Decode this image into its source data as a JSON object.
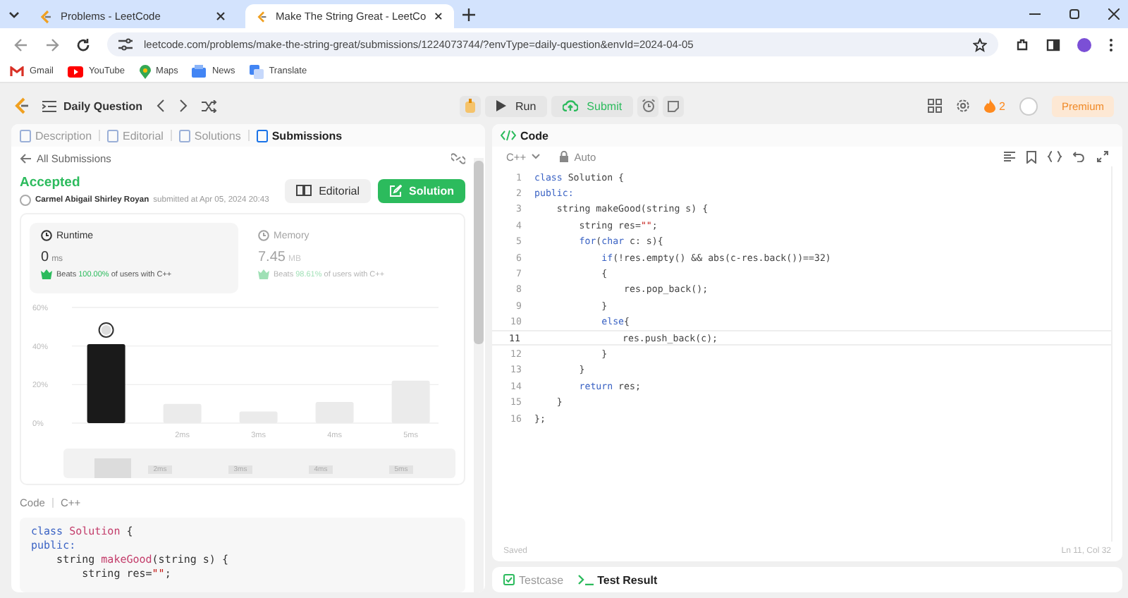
{
  "browser": {
    "tabs": [
      {
        "title": "Problems - LeetCode",
        "selected": false
      },
      {
        "title": "Make The String Great - LeetCo",
        "selected": true
      }
    ],
    "url": "leetcode.com/problems/make-the-string-great/submissions/1224073744/?envType=daily-question&envId=2024-04-05",
    "bookmarks": [
      {
        "label": "Gmail",
        "kind": "mail"
      },
      {
        "label": "YouTube",
        "kind": "video"
      },
      {
        "label": "Maps",
        "kind": "pin"
      },
      {
        "label": "News",
        "kind": "news"
      },
      {
        "label": "Translate",
        "kind": "translate"
      }
    ]
  },
  "toolbar": {
    "title": "Daily Question",
    "run": "Run",
    "submit": "Submit",
    "streak": "2",
    "premium": "Premium"
  },
  "left": {
    "tabs": [
      {
        "label": "Description",
        "selected": false
      },
      {
        "label": "Editorial",
        "selected": false
      },
      {
        "label": "Solutions",
        "selected": false
      },
      {
        "label": "Submissions",
        "selected": true
      }
    ],
    "back": "All Submissions",
    "status": "Accepted",
    "author": "Carmel Abigail Shirley Royan",
    "submitted": "submitted at Apr 05, 2024 20:43",
    "editorial_button": "Editorial",
    "solution_button": "Solution",
    "stats": [
      {
        "label": "Runtime",
        "value": "0",
        "unit": "ms",
        "beats": "Beats",
        "percent": "100.00%",
        "suffix": "of users with C++",
        "selected": true
      },
      {
        "label": "Memory",
        "value": "7.45",
        "unit": "MB",
        "beats": "Beats",
        "percent": "98.61%",
        "suffix": "of users with C++",
        "selected": false
      }
    ],
    "chart_data": {
      "type": "bar",
      "categories": [
        null,
        "2ms",
        "3ms",
        "4ms",
        "5ms"
      ],
      "values": [
        41,
        10,
        6,
        11,
        22
      ],
      "ylim": [
        0,
        60
      ],
      "yticks": [
        {
          "value": 0,
          "label": "0%"
        },
        {
          "value": 20,
          "label": "20%"
        },
        {
          "value": 40,
          "label": "40%"
        },
        {
          "value": 60,
          "label": "60%"
        }
      ]
    },
    "overview_labels": [
      "2ms",
      "3ms",
      "4ms",
      "5ms"
    ],
    "code_label": "Code",
    "code_lang": "C++",
    "snippet": [
      [
        {
          "t": "class ",
          "kind": "keyword"
        },
        {
          "t": "Solution",
          "kind": "name"
        },
        {
          "t": " {",
          "kind": "plain"
        }
      ],
      [
        {
          "t": "public:",
          "kind": "keyword"
        }
      ],
      [
        {
          "t": "    string ",
          "kind": "plain"
        },
        {
          "t": "makeGood",
          "kind": "name"
        },
        {
          "t": "(string s) {",
          "kind": "plain"
        }
      ],
      [
        {
          "t": "        string res=",
          "kind": "plain"
        },
        {
          "t": "\"\"",
          "kind": "string"
        },
        {
          "t": ";",
          "kind": "plain"
        }
      ]
    ]
  },
  "editor": {
    "title": "Code",
    "lang": "C++",
    "mode": "Auto",
    "status": "Saved",
    "position": "Ln 11, Col 32",
    "lines": [
      {
        "n": "1",
        "current": false,
        "segments": [
          {
            "t": "class ",
            "kind": "keyword"
          },
          {
            "t": "Solution {",
            "kind": "plain"
          }
        ]
      },
      {
        "n": "2",
        "current": false,
        "segments": [
          {
            "t": "public:",
            "kind": "keyword"
          }
        ]
      },
      {
        "n": "3",
        "current": false,
        "segments": [
          {
            "t": "    string makeGood(string s) {",
            "kind": "plain"
          }
        ]
      },
      {
        "n": "4",
        "current": false,
        "segments": [
          {
            "t": "        string res=",
            "kind": "plain"
          },
          {
            "t": "\"\"",
            "kind": "string"
          },
          {
            "t": ";",
            "kind": "plain"
          }
        ]
      },
      {
        "n": "5",
        "current": false,
        "segments": [
          {
            "t": "        for",
            "kind": "keyword"
          },
          {
            "t": "(",
            "kind": "plain"
          },
          {
            "t": "char",
            "kind": "keyword"
          },
          {
            "t": " c: s){",
            "kind": "plain"
          }
        ]
      },
      {
        "n": "6",
        "current": false,
        "segments": [
          {
            "t": "            if",
            "kind": "keyword"
          },
          {
            "t": "(!res.empty() && abs(c-res.back())==32)",
            "kind": "plain"
          }
        ]
      },
      {
        "n": "7",
        "current": false,
        "segments": [
          {
            "t": "            {",
            "kind": "plain"
          }
        ]
      },
      {
        "n": "8",
        "current": false,
        "segments": [
          {
            "t": "                res.pop_back();",
            "kind": "plain"
          }
        ]
      },
      {
        "n": "9",
        "current": false,
        "segments": [
          {
            "t": "            }",
            "kind": "plain"
          }
        ]
      },
      {
        "n": "10",
        "current": false,
        "segments": [
          {
            "t": "            else",
            "kind": "keyword"
          },
          {
            "t": "{",
            "kind": "plain"
          }
        ]
      },
      {
        "n": "11",
        "current": true,
        "segments": [
          {
            "t": "                res.push_back(c);",
            "kind": "plain"
          }
        ]
      },
      {
        "n": "12",
        "current": false,
        "segments": [
          {
            "t": "            }",
            "kind": "plain"
          }
        ]
      },
      {
        "n": "13",
        "current": false,
        "segments": [
          {
            "t": "        }",
            "kind": "plain"
          }
        ]
      },
      {
        "n": "14",
        "current": false,
        "segments": [
          {
            "t": "        return",
            "kind": "keyword"
          },
          {
            "t": " res;",
            "kind": "plain"
          }
        ]
      },
      {
        "n": "15",
        "current": false,
        "segments": [
          {
            "t": "    }",
            "kind": "plain"
          }
        ]
      },
      {
        "n": "16",
        "current": false,
        "segments": [
          {
            "t": "};",
            "kind": "plain"
          }
        ]
      }
    ],
    "bottom_tabs": [
      {
        "label": "Testcase",
        "selected": false
      },
      {
        "label": "Test Result",
        "selected": true
      }
    ]
  }
}
